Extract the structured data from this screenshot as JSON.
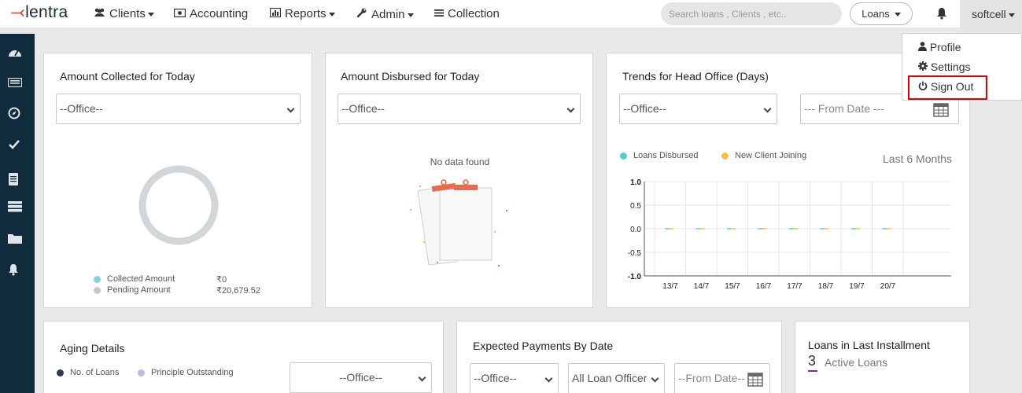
{
  "nav": {
    "brand": "lentra",
    "items": {
      "clients": "Clients",
      "accounting": "Accounting",
      "reports": "Reports",
      "admin": "Admin",
      "collection": "Collection"
    },
    "search_placeholder": "Search loans , Clients , etc..",
    "loans_label": "Loans",
    "user": "softcell"
  },
  "user_menu": {
    "profile": "Profile",
    "settings": "Settings",
    "sign_out": "Sign Out"
  },
  "collected_today": {
    "title": "Amount Collected for Today",
    "office_select": "--Office--",
    "legend": [
      {
        "label": "Collected Amount",
        "value": "₹0",
        "color": "#7fd3df"
      },
      {
        "label": "Pending Amount",
        "value": "₹20,679.52",
        "color": "#c4c8cc"
      }
    ]
  },
  "disbursed_today": {
    "title": "Amount Disbursed for Today",
    "office_select": "--Office--",
    "empty_text": "No data found"
  },
  "trends": {
    "title": "Trends for Head Office (Days)",
    "office_select": "--Office--",
    "from_date_placeholder": "--- From Date ---",
    "period_label": "Last 6 Months",
    "legend": [
      {
        "label": "Loans Disbursed",
        "color": "#4dd0d0"
      },
      {
        "label": "New Client Joining",
        "color": "#f7bf45"
      }
    ]
  },
  "aging": {
    "title": "Aging Details",
    "legend": [
      {
        "label": "No. of Loans",
        "color": "#2f3a4e"
      },
      {
        "label": "Principle Outstanding",
        "color": "#b9bde3"
      }
    ],
    "office_select": "--Office--"
  },
  "expected": {
    "title": "Expected Payments By Date",
    "office_select": "--Office--",
    "officer_select": "All Loan Officer",
    "from_date_placeholder": "--From Date--"
  },
  "last_installment": {
    "title": "Loans in Last Installment",
    "count": "3",
    "label": "Active Loans"
  },
  "chart_data": {
    "type": "line",
    "categories": [
      "13/7",
      "14/7",
      "15/7",
      "16/7",
      "17/7",
      "18/7",
      "19/7",
      "20/7"
    ],
    "series": [
      {
        "name": "Loans Disbursed",
        "values": [
          0,
          0,
          0,
          0,
          0,
          0,
          0,
          0
        ],
        "color": "#4dd0d0"
      },
      {
        "name": "New Client Joining",
        "values": [
          0,
          0,
          0,
          0,
          0,
          0,
          0,
          0
        ],
        "color": "#f7bf45"
      }
    ],
    "yticks": [
      "1.0",
      "0.5",
      "0.0",
      "-0.5",
      "-1.0"
    ],
    "ylim": [
      -1.0,
      1.0
    ],
    "grid": true
  }
}
